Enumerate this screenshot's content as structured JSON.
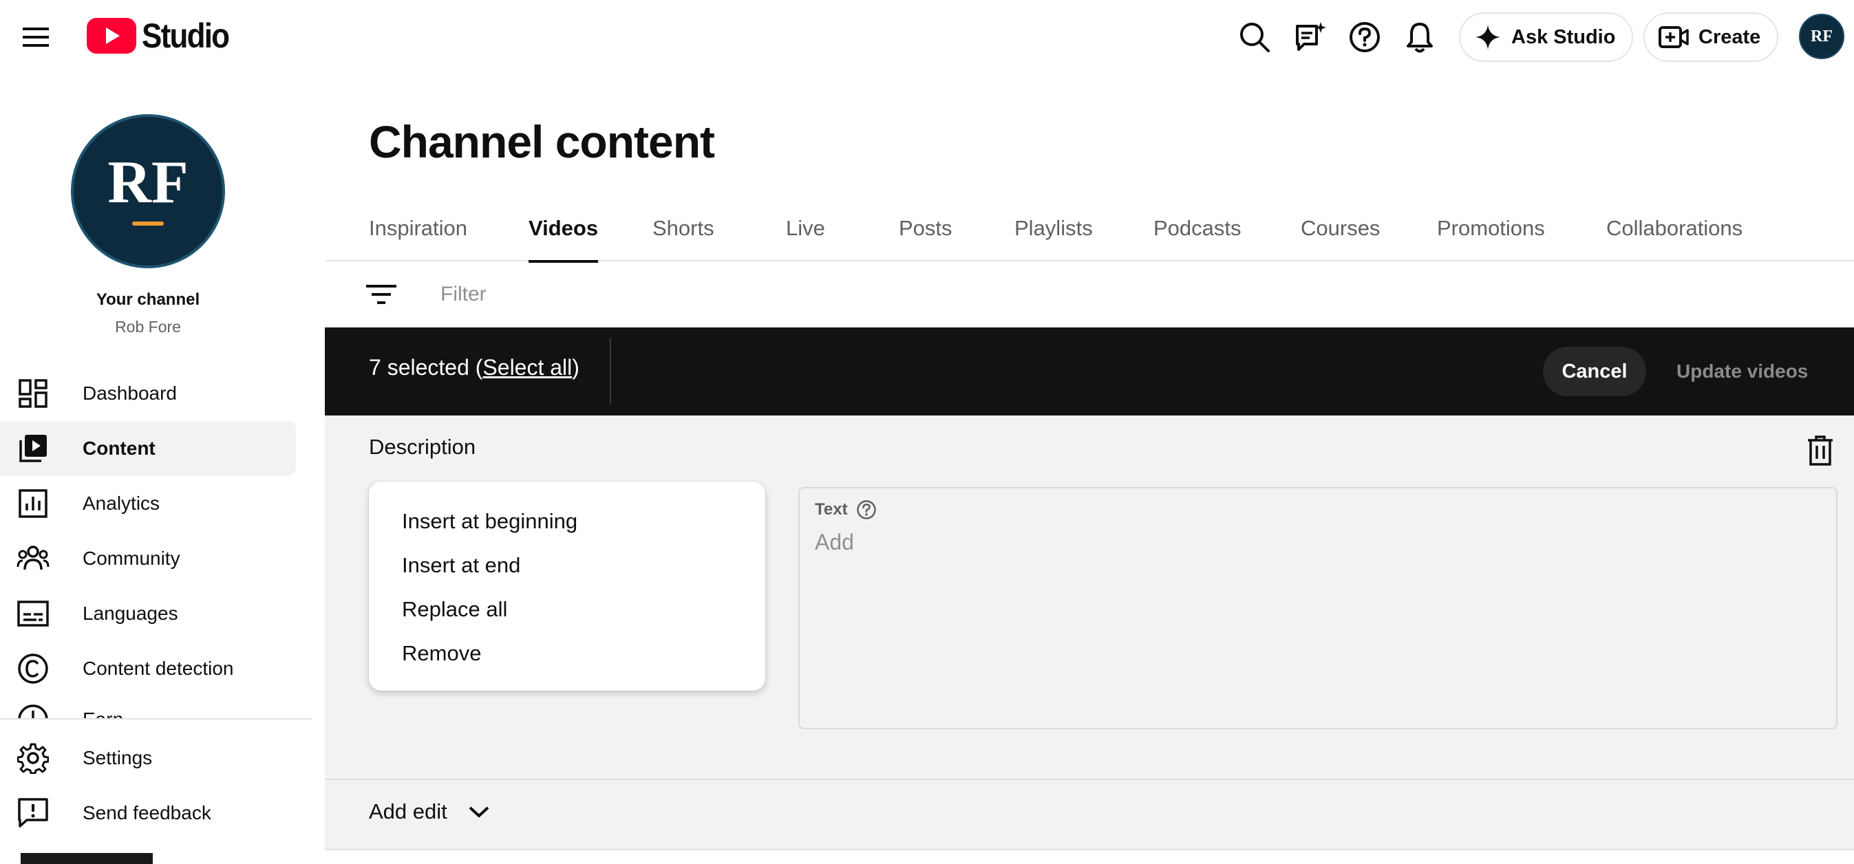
{
  "app": {
    "name": "Studio"
  },
  "header": {
    "ask_studio": "Ask Studio",
    "create": "Create",
    "avatar_initials": "RF"
  },
  "sidebar": {
    "avatar_initials": "RF",
    "your_channel": "Your channel",
    "channel_name": "Rob Fore",
    "items": [
      {
        "label": "Dashboard",
        "icon": "dashboard-icon",
        "active": false
      },
      {
        "label": "Content",
        "icon": "content-icon",
        "active": true
      },
      {
        "label": "Analytics",
        "icon": "analytics-icon",
        "active": false
      },
      {
        "label": "Community",
        "icon": "community-icon",
        "active": false
      },
      {
        "label": "Languages",
        "icon": "subtitles-icon",
        "active": false
      },
      {
        "label": "Content detection",
        "icon": "copyright-icon",
        "active": false
      },
      {
        "label": "Earn",
        "icon": "earn-icon",
        "active": false
      }
    ],
    "footer": [
      {
        "label": "Settings",
        "icon": "gear-icon"
      },
      {
        "label": "Send feedback",
        "icon": "feedback-icon"
      }
    ]
  },
  "main": {
    "title": "Channel content",
    "tabs": [
      "Inspiration",
      "Videos",
      "Shorts",
      "Live",
      "Posts",
      "Playlists",
      "Podcasts",
      "Courses",
      "Promotions",
      "Collaborations"
    ],
    "active_tab": "Videos",
    "filter_placeholder": "Filter",
    "selection": {
      "count_text": "7 selected (",
      "select_all": "Select all",
      "close_paren": ")",
      "cancel": "Cancel",
      "update": "Update videos"
    },
    "edit": {
      "field": "Description",
      "options": [
        "Insert at beginning",
        "Insert at end",
        "Replace all",
        "Remove"
      ],
      "text_label": "Text",
      "text_placeholder": "Add",
      "add_edit": "Add edit"
    }
  },
  "colors": {
    "brand_red": "#ff0033",
    "selection_bar": "#121212",
    "panel_bg": "#f2f2f2"
  }
}
